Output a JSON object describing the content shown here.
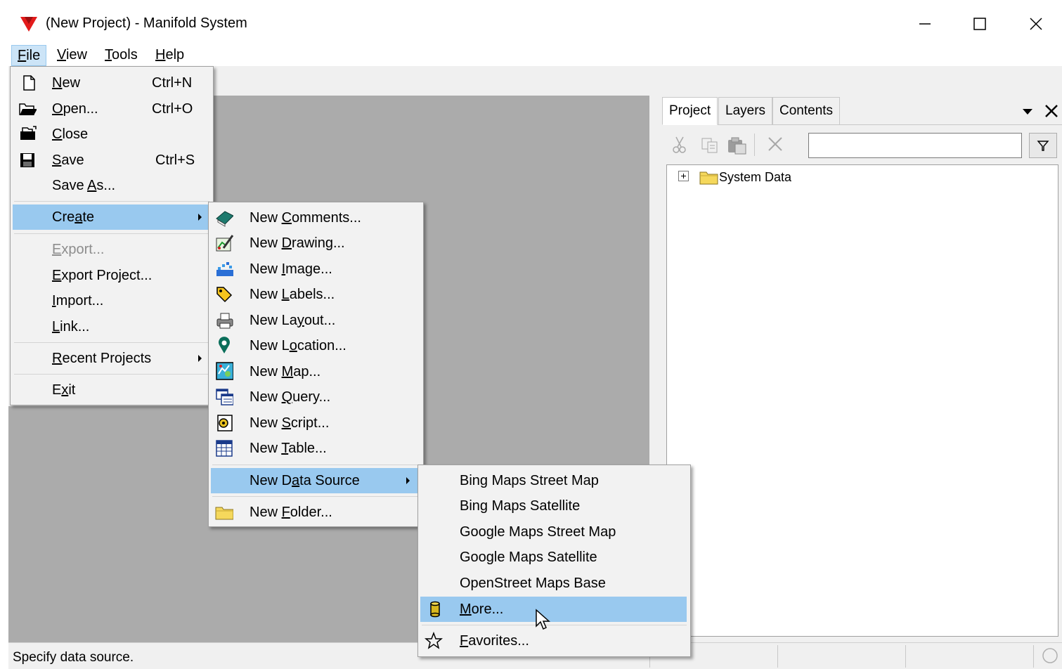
{
  "window": {
    "title": "(New Project) - Manifold System"
  },
  "menubar": [
    {
      "key": "F",
      "rest": "ile"
    },
    {
      "key": "V",
      "rest": "iew"
    },
    {
      "key": "T",
      "rest": "ools"
    },
    {
      "key": "H",
      "rest": "elp"
    }
  ],
  "file_menu": {
    "new": {
      "pre": "",
      "key": "N",
      "post": "ew",
      "shortcut": "Ctrl+N"
    },
    "open": {
      "pre": "",
      "key": "O",
      "post": "pen...",
      "shortcut": "Ctrl+O"
    },
    "close": {
      "pre": "",
      "key": "C",
      "post": "lose"
    },
    "save": {
      "pre": "",
      "key": "S",
      "post": "ave",
      "shortcut": "Ctrl+S"
    },
    "save_as": {
      "pre": "Save ",
      "key": "A",
      "post": "s..."
    },
    "create": {
      "pre": "Cre",
      "key": "a",
      "post": "te"
    },
    "export": {
      "pre": "",
      "key": "E",
      "post": "xport..."
    },
    "export_project": {
      "pre": "",
      "key": "E",
      "post": "xport Project..."
    },
    "import": {
      "pre": "",
      "key": "I",
      "post": "mport..."
    },
    "link": {
      "pre": "",
      "key": "L",
      "post": "ink..."
    },
    "recent_projects": {
      "pre": "",
      "key": "R",
      "post": "ecent Projects"
    },
    "exit": {
      "pre": "E",
      "key": "x",
      "post": "it"
    }
  },
  "create_menu": {
    "comments": {
      "pre": "New ",
      "key": "C",
      "post": "omments..."
    },
    "drawing": {
      "pre": "New ",
      "key": "D",
      "post": "rawing..."
    },
    "image": {
      "pre": "New ",
      "key": "I",
      "post": "mage..."
    },
    "labels": {
      "pre": "New ",
      "key": "L",
      "post": "abels..."
    },
    "layout": {
      "pre": "New La",
      "key": "y",
      "post": "out..."
    },
    "location": {
      "pre": "New L",
      "key": "o",
      "post": "cation..."
    },
    "map": {
      "pre": "New ",
      "key": "M",
      "post": "ap..."
    },
    "query": {
      "pre": "New ",
      "key": "Q",
      "post": "uery..."
    },
    "script": {
      "pre": "New ",
      "key": "S",
      "post": "cript..."
    },
    "table": {
      "pre": "New ",
      "key": "T",
      "post": "able..."
    },
    "data_source": {
      "pre": "New D",
      "key": "a",
      "post": "ta Source"
    },
    "folder": {
      "pre": "New ",
      "key": "F",
      "post": "older..."
    }
  },
  "datasource_menu": {
    "bing_street": "Bing Maps Street Map",
    "bing_sat": "Bing Maps Satellite",
    "google_street": "Google Maps Street Map",
    "google_sat": "Google Maps Satellite",
    "osm": "OpenStreet Maps Base",
    "more": {
      "pre": "",
      "key": "M",
      "post": "ore..."
    },
    "favorites": {
      "pre": "",
      "key": "F",
      "post": "avorites..."
    }
  },
  "panel": {
    "tabs": [
      "Project",
      "Layers",
      "Contents"
    ],
    "search_value": "",
    "tree_items": [
      "System Data"
    ]
  },
  "status": {
    "text": "Specify data source."
  },
  "colors": {
    "highlight": "#99c9ef",
    "menu_bg": "#f2f2f2",
    "workspace": "#ababab",
    "logo": "#e31b1b"
  }
}
